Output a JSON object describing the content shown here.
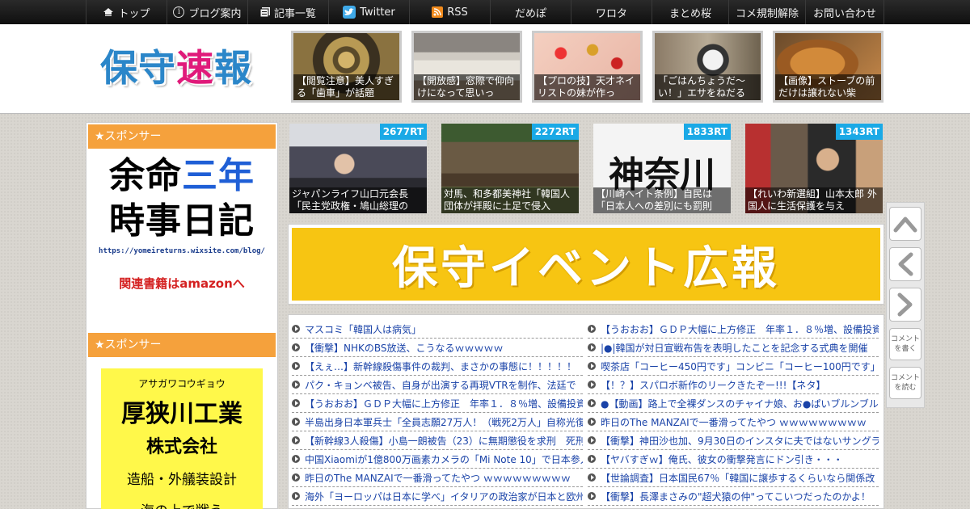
{
  "nav": [
    {
      "label": "トップ",
      "icon": "home-icon"
    },
    {
      "label": "ブログ案内",
      "icon": "info-icon"
    },
    {
      "label": "記事一覧",
      "icon": "list-icon"
    },
    {
      "label": "Twitter",
      "icon": "twitter-icon"
    },
    {
      "label": "RSS",
      "icon": "rss-icon"
    },
    {
      "label": "だめぽ"
    },
    {
      "label": "ワロタ"
    },
    {
      "label": "まとめ桜"
    },
    {
      "label": "コメ規制解除"
    },
    {
      "label": "お問い合わせ"
    }
  ],
  "logo": {
    "c1": "保",
    "c2": "守",
    "c3": "速",
    "c4": "報"
  },
  "header_thumbs": [
    "【閲覧注意】美人すぎる「歯車」が話題",
    "【開放感】窓際で仰向けになって思いっ",
    "【プロの技】天才ネイリストの妹が作っ",
    "「ごはんちょうだ～い！」エサをねだる",
    "【画像】ストーブの前だけは譲れない柴"
  ],
  "sidebar": {
    "head1": "★スポンサー",
    "ad1": {
      "line1a": "余命",
      "line1b": "三年",
      "line2": "時事日記",
      "url": "https://yomeireturns.wixsite.com/blog/",
      "amazon": "関連書籍はamazonへ"
    },
    "head2": "★スポンサー",
    "ad2": {
      "kana": "アサガワコウギョウ",
      "name": "厚狭川工業",
      "company": "株式会社",
      "business": "造船・外艤装設計",
      "more": "海の上で戦う"
    }
  },
  "ranking": [
    {
      "rt": "2677RT",
      "caption": "ジャパンライフ山口元会長「民主党政権・鳩山総理の"
    },
    {
      "rt": "2272RT",
      "caption": "対馬、和多都美神社「韓国人団体が拝殿に土足で侵入"
    },
    {
      "rt": "1833RT",
      "caption": "【川崎ヘイト条例】自民は「日本人への差別にも罰則"
    },
    {
      "rt": "1343RT",
      "caption": "【れいわ新選組】山本太郎 外国人に生活保護を与え"
    }
  ],
  "banner": {
    "text": "保守イベント広報"
  },
  "links_left": [
    "マスコミ「韓国人は病気」",
    "【衝撃】NHKのBS放送、こうなるｗｗｗｗｗ",
    "【えぇ…】新幹線殺傷事件の裁判、まさかの事態に！！！！！",
    "パク・キョンベ被告、自身が出演する再現VTRを制作、法廷で",
    "【うおおお】ＧＤＰ大幅に上方修正　年率１．８％増、設備投資",
    "半島出身日本軍兵士「全員志願27万人！（戦死2万人」自称光復",
    "【新幹線3人殺傷】小島一朗被告（23）に無期懲役を求刑　死刑",
    "中国Xiaomiが1億800万画素カメラの「Mi Note 10」で日本参入",
    "昨日のThe MANZAIで一番滑ってたやつ ｗｗｗｗｗｗｗｗｗ",
    "海外「ヨーロッパは日本に学べ」イタリアの政治家が日本と欧州"
  ],
  "links_right": [
    "【うおおお】ＧＤＰ大幅に上方修正　年率１．８％増、設備投資",
    "|●|韓国が対日宣戦布告を表明したことを記念する式典を開催",
    "喫茶店「コーヒー450円です」コンビニ「コーヒー100円です」",
    "【！？】スパロボ新作のリークきたぞー!!!【ネタ】",
    "●【動画】路上で全裸ダンスのチャイナ娘、お●ぱいブルンブル",
    "昨日のThe MANZAIで一番滑ってたやつ ｗｗｗｗｗｗｗｗｗ",
    "【衝撃】神田沙也加、9月30日のインスタに夫ではないサングラ",
    "【ヤバすぎｗ】俺氏、彼女の衝撃発言にドン引き・・・",
    "【世論調査】日本国民67％「韓国に譲歩するくらいなら関係改",
    "【衝撃】長澤まさみの\"超犬猿の仲\"ってこいつだったのかよ！"
  ],
  "float": {
    "comment_write": "コメントを書く",
    "comment_read": "コメントを読む"
  }
}
